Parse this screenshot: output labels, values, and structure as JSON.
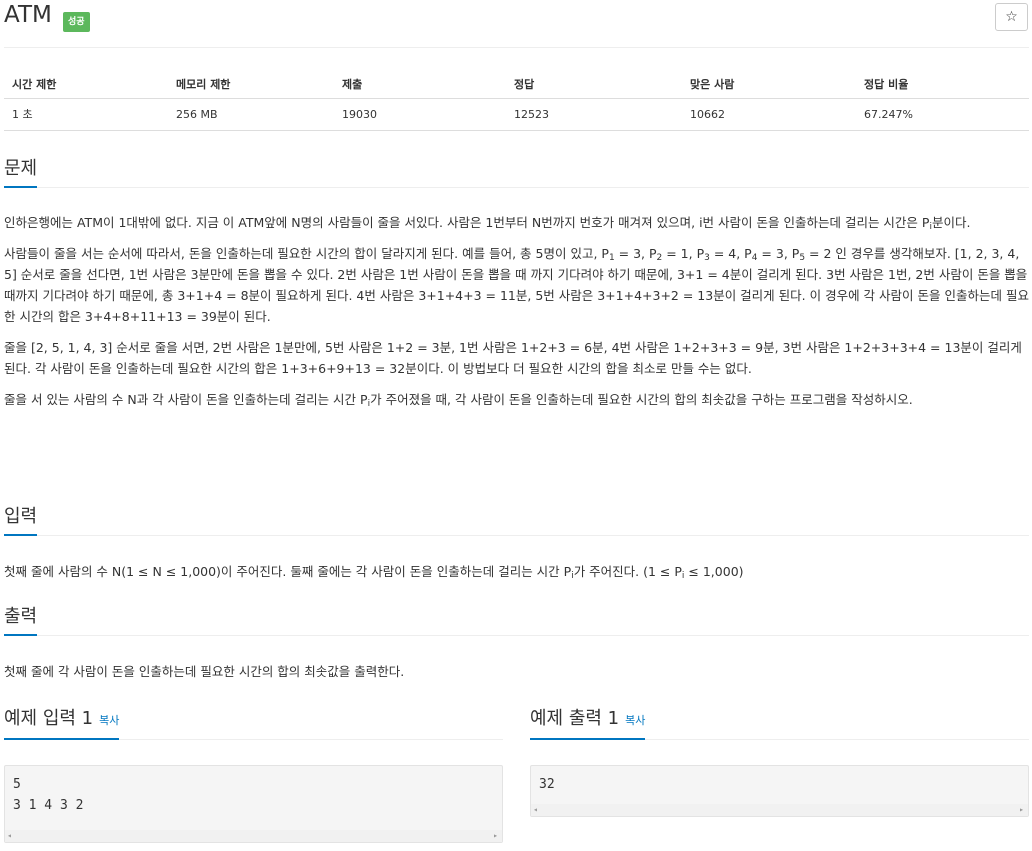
{
  "problem": {
    "title": "ATM",
    "badge": "성공",
    "star_icon": "☆"
  },
  "info_table": {
    "headers": [
      "시간 제한",
      "메모리 제한",
      "제출",
      "정답",
      "맞은 사람",
      "정답 비율"
    ],
    "values": [
      "1 초",
      "256 MB",
      "19030",
      "12523",
      "10662",
      "67.247%"
    ]
  },
  "sections": {
    "problem_title": "문제",
    "input_title": "입력",
    "output_title": "출력",
    "sample_input_title": "예제 입력 1",
    "sample_output_title": "예제 출력 1",
    "copy_label": "복사"
  },
  "description": {
    "p1a": "인하은행에는 ATM이 1대밖에 없다. 지금 이 ATM앞에 N명의 사람들이 줄을 서있다. 사람은 1번부터 N번까지 번호가 매겨져 있으며, i번 사람이 돈을 인출하는데 걸리는 시간은 P",
    "p1sub": "i",
    "p1b": "분이다.",
    "p2a": "사람들이 줄을 서는 순서에 따라서, 돈을 인출하는데 필요한 시간의 합이 달라지게 된다. 예를 들어, 총 5명이 있고, P",
    "p2s1": "1",
    "p2t1": " = 3, P",
    "p2s2": "2",
    "p2t2": " = 1, P",
    "p2s3": "3",
    "p2t3": " = 4, P",
    "p2s4": "4",
    "p2t4": " = 3, P",
    "p2s5": "5",
    "p2b": " = 2 인 경우를 생각해보자. [1, 2, 3, 4, 5] 순서로 줄을 선다면, 1번 사람은 3분만에 돈을 뽑을 수 있다. 2번 사람은 1번 사람이 돈을 뽑을 때 까지 기다려야 하기 때문에, 3+1 = 4분이 걸리게 된다. 3번 사람은 1번, 2번 사람이 돈을 뽑을 때까지 기다려야 하기 때문에, 총 3+1+4 = 8분이 필요하게 된다. 4번 사람은 3+1+4+3 = 11분, 5번 사람은 3+1+4+3+2 = 13분이 걸리게 된다. 이 경우에 각 사람이 돈을 인출하는데 필요한 시간의 합은 3+4+8+11+13 = 39분이 된다.",
    "p3": "줄을 [2, 5, 1, 4, 3] 순서로 줄을 서면, 2번 사람은 1분만에, 5번 사람은 1+2 = 3분, 1번 사람은 1+2+3 = 6분, 4번 사람은 1+2+3+3 = 9분, 3번 사람은 1+2+3+3+4 = 13분이 걸리게 된다. 각 사람이 돈을 인출하는데 필요한 시간의 합은 1+3+6+9+13 = 32분이다. 이 방법보다 더 필요한 시간의 합을 최소로 만들 수는 없다.",
    "p4a": "줄을 서 있는 사람의 수 N과 각 사람이 돈을 인출하는데 걸리는 시간 P",
    "p4sub": "i",
    "p4b": "가 주어졌을 때, 각 사람이 돈을 인출하는데 필요한 시간의 합의 최솟값을 구하는 프로그램을 작성하시오."
  },
  "input": {
    "a": "첫째 줄에 사람의 수 N(1 ≤ N ≤ 1,000)이 주어진다. 둘째 줄에는 각 사람이 돈을 인출하는데 걸리는 시간 P",
    "sub1": "i",
    "b": "가 주어진다. (1 ≤ P",
    "sub2": "i",
    "c": " ≤ 1,000)"
  },
  "output": {
    "text": "첫째 줄에 각 사람이 돈을 인출하는데 필요한 시간의 합의 최솟값을 출력한다."
  },
  "sample_input": {
    "line1": "5",
    "line2": "3 1 4 3 2"
  },
  "sample_output": {
    "line1": "32"
  },
  "scroll_arrows": {
    "left": "◂",
    "right": "▸"
  }
}
